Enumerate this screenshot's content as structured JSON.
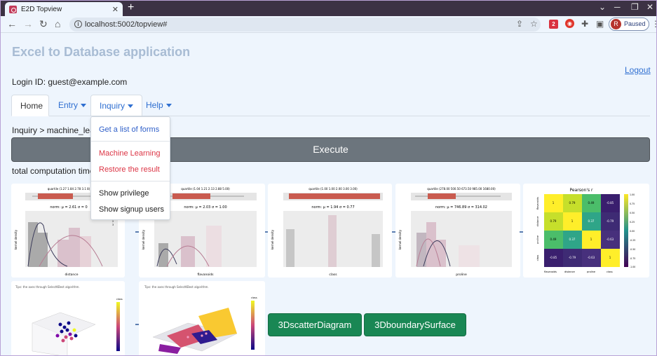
{
  "browser": {
    "tab_title": "E2D Topview",
    "tab_close": "✕",
    "new_tab": "+",
    "url": "localhost:5002/topview#",
    "profile_initial": "R",
    "profile_status": "Paused",
    "extension_badge": "2",
    "window_minimize": "─",
    "window_restore": "❐",
    "window_close": "✕"
  },
  "app": {
    "title": "Excel to Database application",
    "logout": "Logout",
    "login": "Login ID: guest@example.com"
  },
  "nav": {
    "tabs": [
      {
        "label": "Home"
      },
      {
        "label": "Entry"
      },
      {
        "label": "Inquiry"
      },
      {
        "label": "Help"
      }
    ]
  },
  "dropdown": {
    "items": [
      {
        "label": "Get a list of forms",
        "color": "#2f5fc9"
      },
      {
        "label": "Machine Learning",
        "color": "#dc3545"
      },
      {
        "label": "Restore the result",
        "color": "#dc3545"
      },
      {
        "label": "Show privilege",
        "color": "#222222"
      },
      {
        "label": "Show signup users",
        "color": "#222222"
      }
    ]
  },
  "breadcrumb": "Inquiry > machine_lear",
  "execute_label": "Execute",
  "computation_time_label": "total computation time",
  "charts": {
    "dist1": {
      "box_label": "quartile (1.27 1.84 2.78 3.1 8)",
      "norm_label": "norm: μ = 2.61  σ = 0",
      "xlabel": "distance",
      "ylabel": "kernel density"
    },
    "dist2": {
      "box_label": "quartile (1.04 1.21 2.13 2.88 5.00)",
      "norm_label": "norm: μ = 2.03  σ = 1.00",
      "xlabel": "flavanoids",
      "ylabel": "kernel density"
    },
    "dist3": {
      "box_label": "quartile (1.00 1.00 2.00 3.00 3.00)",
      "norm_label": "norm: μ = 1.94  σ = 0.77",
      "xlabel": "class",
      "ylabel": "kernel density"
    },
    "dist4": {
      "box_label": "quartile (278.00 500.50 673.50 985.00 1680.00)",
      "norm_label": "norm: μ = 746.89  σ = 314.02",
      "xlabel": "proline",
      "ylabel": "kernel density"
    },
    "legend_title": "class",
    "legend_items": [
      "1",
      "2",
      "3"
    ],
    "heatmap": {
      "title": "Pearson's r",
      "labels": [
        "flavanoids",
        "distance",
        "proline",
        "class"
      ],
      "cells": [
        [
          "1",
          "0.79",
          "0.49",
          "-0.85"
        ],
        [
          "0.79",
          "1",
          "0.37",
          "-0.79"
        ],
        [
          "0.49",
          "0.37",
          "1",
          "-0.63"
        ],
        [
          "-0.85",
          "-0.79",
          "-0.63",
          "1"
        ]
      ],
      "scale_ticks": [
        "1.00",
        "0.75",
        "0.50",
        "0.25",
        "0.00",
        "-0.25",
        "-0.50",
        "-0.75",
        "-1.00"
      ]
    },
    "scatter3d": {
      "tip": "Tips: the axes through SelectKBest algorithm.",
      "colorbar_title": "class"
    },
    "surface3d": {
      "tip": "Tips: the axes through SelectKBest algorithm.",
      "colorbar_title": "class"
    }
  },
  "buttons": {
    "scatter": "3DscatterDiagram",
    "boundary": "3DboundarySurface"
  }
}
